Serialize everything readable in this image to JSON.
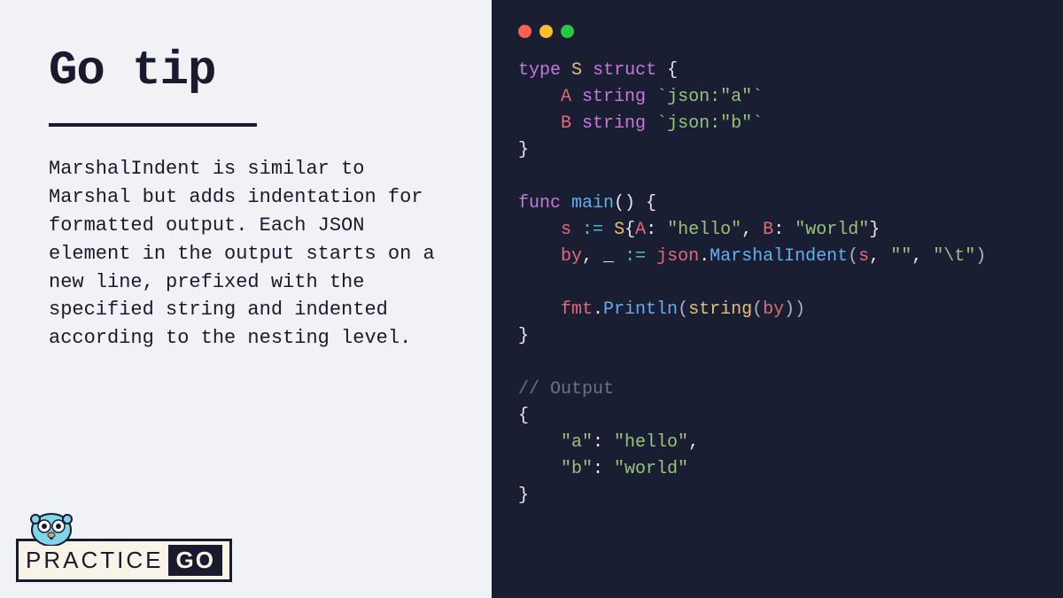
{
  "title": "Go tip",
  "description": "MarshalIndent is similar to Marshal but adds indentation for formatted output. Each JSON element in the output starts on a new line, prefixed with the specified string and indented according to the nesting level.",
  "logo": {
    "practice": "PRACTICE",
    "go": "GO"
  },
  "code": {
    "line1_type": "type",
    "line1_name": "S",
    "line1_struct": "struct",
    "line1_brace": " {",
    "line2_field": "A",
    "line2_type": "string",
    "line2_tag": "`json:\"a\"`",
    "line3_field": "B",
    "line3_type": "string",
    "line3_tag": "`json:\"b\"`",
    "line4": "}",
    "line6_func": "func",
    "line6_main": "main",
    "line6_parens": "() {",
    "line7_var": "s",
    "line7_op": ":=",
    "line7_type": "S",
    "line7_brace_open": "{",
    "line7_fieldA": "A",
    "line7_colon1": ": ",
    "line7_valA": "\"hello\"",
    "line7_comma": ", ",
    "line7_fieldB": "B",
    "line7_colon2": ": ",
    "line7_valB": "\"world\"",
    "line7_brace_close": "}",
    "line8_var": "by",
    "line8_comma": ", ",
    "line8_under": "_",
    "line8_op": " := ",
    "line8_pkg": "json",
    "line8_dot": ".",
    "line8_func": "MarshalIndent",
    "line8_open": "(",
    "line8_arg1": "s",
    "line8_c1": ", ",
    "line8_arg2": "\"\"",
    "line8_c2": ", ",
    "line8_arg3": "\"\\t\"",
    "line8_close": ")",
    "line10_pkg": "fmt",
    "line10_dot": ".",
    "line10_func": "Println",
    "line10_open": "(",
    "line10_string": "string",
    "line10_open2": "(",
    "line10_arg": "by",
    "line10_close": "))",
    "line11": "}",
    "comment": "// Output",
    "out1": "{",
    "out2_key": "\"a\"",
    "out2_colon": ": ",
    "out2_val": "\"hello\"",
    "out2_comma": ",",
    "out3_key": "\"b\"",
    "out3_colon": ": ",
    "out3_val": "\"world\"",
    "out4": "}"
  }
}
